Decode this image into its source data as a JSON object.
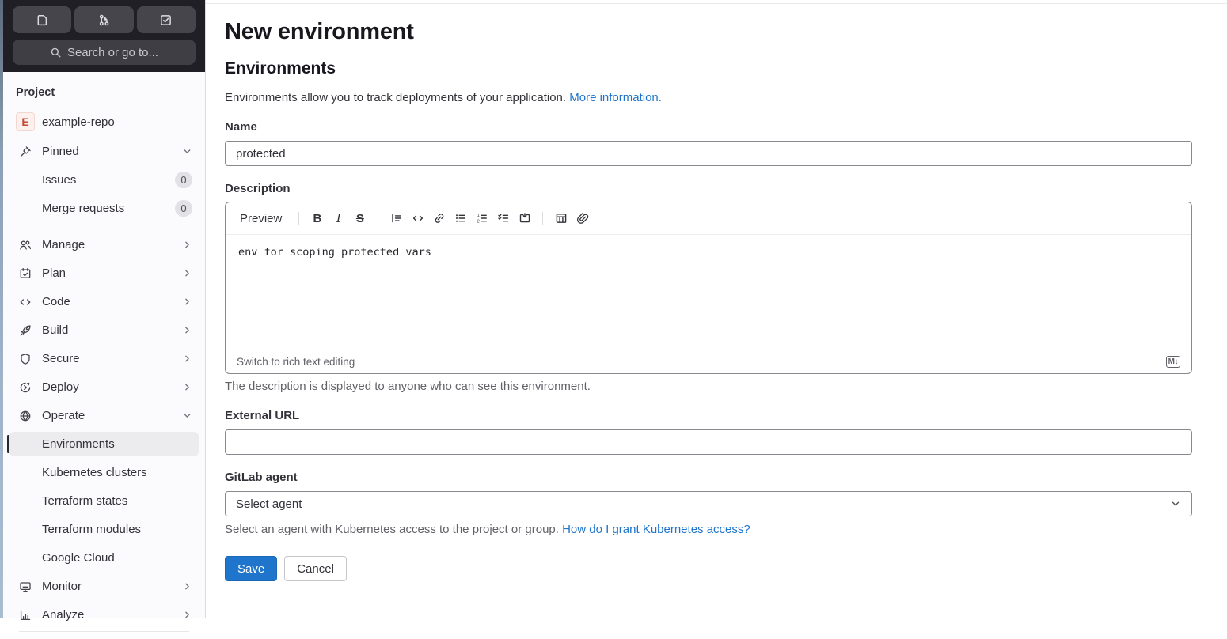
{
  "colors": {
    "accent_blue": "#1f75cb",
    "dark_header_bg": "#211f26",
    "sidebar_active_bg": "#ececef",
    "save_button_bg": "#1f75cb"
  },
  "topbar": {
    "search_placeholder": "Search or go to...",
    "shortcut_icons": [
      "issues-icon",
      "merge-request-icon",
      "todo-icon"
    ]
  },
  "sidebar": {
    "section_label": "Project",
    "project": {
      "avatar_letter": "E",
      "name": "example-repo"
    },
    "pinned": {
      "label": "Pinned",
      "items": [
        {
          "label": "Issues",
          "badge": "0"
        },
        {
          "label": "Merge requests",
          "badge": "0"
        }
      ]
    },
    "nav": [
      {
        "label": "Manage",
        "icon": "users"
      },
      {
        "label": "Plan",
        "icon": "calendar-check"
      },
      {
        "label": "Code",
        "icon": "code"
      },
      {
        "label": "Build",
        "icon": "rocket"
      },
      {
        "label": "Secure",
        "icon": "shield"
      },
      {
        "label": "Deploy",
        "icon": "deploy"
      },
      {
        "label": "Operate",
        "icon": "globe"
      }
    ],
    "operate_children": [
      {
        "label": "Environments",
        "active": true
      },
      {
        "label": "Kubernetes clusters"
      },
      {
        "label": "Terraform states"
      },
      {
        "label": "Terraform modules"
      },
      {
        "label": "Google Cloud"
      }
    ],
    "nav_bottom": [
      {
        "label": "Monitor",
        "icon": "monitor"
      },
      {
        "label": "Analyze",
        "icon": "chart"
      }
    ]
  },
  "main": {
    "page_title": "New environment",
    "section_title": "Environments",
    "intro": {
      "text": "Environments allow you to track deployments of your application. ",
      "link": "More information."
    },
    "form": {
      "name": {
        "label": "Name",
        "value": "protected"
      },
      "description": {
        "label": "Description",
        "toolbar": {
          "preview_label": "Preview",
          "icons": [
            "bold",
            "italic",
            "strikethrough",
            "quote",
            "code",
            "link",
            "bullet-list",
            "ordered-list",
            "task-list",
            "collapsible-section",
            "table",
            "attach-file"
          ]
        },
        "value": "env for scoping protected vars",
        "switch_label": "Switch to rich text editing",
        "markdown_badge": "M↓",
        "help": "The description is displayed to anyone who can see this environment."
      },
      "external_url": {
        "label": "External URL",
        "value": ""
      },
      "gitlab_agent": {
        "label": "GitLab agent",
        "selected_option": "Select agent",
        "help_text": "Select an agent with Kubernetes access to the project or group. ",
        "help_link": "How do I grant Kubernetes access?"
      },
      "actions": {
        "save_label": "Save",
        "cancel_label": "Cancel"
      }
    }
  }
}
